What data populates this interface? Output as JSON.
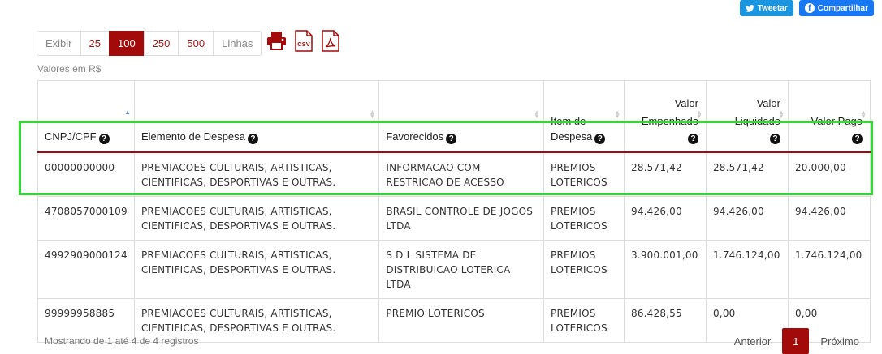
{
  "social": {
    "tweet": "Tweetar",
    "share": "Compartilhar"
  },
  "pager_top": {
    "show_label": "Exibir",
    "options": [
      "25",
      "100",
      "250",
      "500"
    ],
    "active": "100",
    "rows_label": "Linhas"
  },
  "tools": [
    "print-icon",
    "csv-icon",
    "pdf-icon"
  ],
  "currency_note": "Valores em R$",
  "table": {
    "headers": [
      {
        "pre": "",
        "label": "CNPJ/CPF"
      },
      {
        "pre": "",
        "label": "Elemento de Despesa"
      },
      {
        "pre": "",
        "label": "Favorecidos"
      },
      {
        "pre": "Item de",
        "label": "Despesa"
      },
      {
        "pre1": "Valor",
        "pre2": "Empenhado",
        "label": ""
      },
      {
        "pre1": "Valor",
        "pre2": "Liquidado",
        "label": ""
      },
      {
        "pre": "Valor Pago",
        "label": ""
      }
    ],
    "rows": [
      [
        "00000000000",
        "PREMIACOES CULTURAIS, ARTISTICAS, CIENTIFICAS, DESPORTIVAS E OUTRAS.",
        "INFORMACAO COM RESTRICAO DE ACESSO",
        "PREMIOS LOTERICOS",
        "28.571,42",
        "28.571,42",
        "20.000,00"
      ],
      [
        "4708057000109",
        "PREMIACOES CULTURAIS, ARTISTICAS, CIENTIFICAS, DESPORTIVAS E OUTRAS.",
        "BRASIL CONTROLE DE JOGOS LTDA",
        "PREMIOS LOTERICOS",
        "94.426,00",
        "94.426,00",
        "94.426,00"
      ],
      [
        "4992909000124",
        "PREMIACOES CULTURAIS, ARTISTICAS, CIENTIFICAS, DESPORTIVAS E OUTRAS.",
        "S D L SISTEMA DE DISTRIBUICAO LOTERICA LTDA",
        "PREMIOS LOTERICOS",
        "3.900.001,00",
        "1.746.124,00",
        "1.746.124,00"
      ],
      [
        "99999958885",
        "PREMIACOES CULTURAIS, ARTISTICAS, CIENTIFICAS, DESPORTIVAS E OUTRAS.",
        "PREMIO LOTERICOS",
        "PREMIOS LOTERICOS",
        "86.428,55",
        "0,00",
        "0,00"
      ]
    ]
  },
  "footer": {
    "info": "Mostrando de 1 até 4 de 4 registros",
    "prev": "Anterior",
    "page": "1",
    "next": "Próximo"
  },
  "colors": {
    "accent": "#a30a0a",
    "highlight": "#2fdc2f"
  }
}
